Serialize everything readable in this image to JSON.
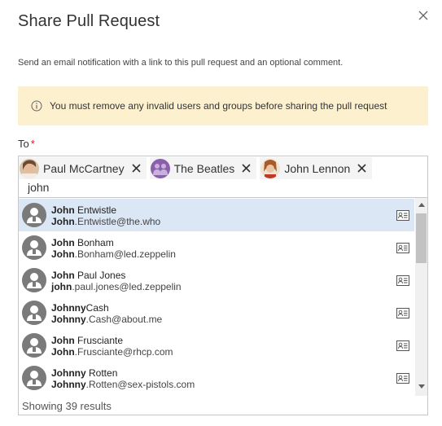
{
  "dialog": {
    "title": "Share Pull Request",
    "description": "Send an email notification with a link to this pull request and an optional comment.",
    "warning": "You must remove any invalid users and groups before sharing the pull request",
    "to_label": "To",
    "required_mark": "*"
  },
  "recipients": [
    {
      "name": "Paul McCartney",
      "avatar": "photo-avatar"
    },
    {
      "name": "The Beatles",
      "avatar": "group-avatar"
    },
    {
      "name": "John Lennon",
      "avatar": "photo-avatar"
    }
  ],
  "search": {
    "query": "john"
  },
  "results": {
    "items": [
      {
        "match": "John",
        "name_rest": " Entwistle",
        "email_match": "John",
        "email_rest": ".Entwistle@the.who",
        "selected": true
      },
      {
        "match": "John",
        "name_rest": " Bonham",
        "email_match": "John",
        "email_rest": ".Bonham@led.zeppelin",
        "selected": false
      },
      {
        "match": "John",
        "name_rest": " Paul Jones",
        "email_match": "john",
        "email_rest": ".paul.jones@led.zeppelin",
        "selected": false
      },
      {
        "match": "Johnny",
        "name_rest": "Cash",
        "email_match": "Johnny",
        "email_rest": ".Cash@about.me",
        "selected": false
      },
      {
        "match": "John",
        "name_rest": " Frusciante",
        "email_match": "John",
        "email_rest": ".Frusciante@rhcp.com",
        "selected": false
      },
      {
        "match": "Johnny",
        "name_rest": " Rotten",
        "email_match": "Johnny",
        "email_rest": ".Rotten@sex-pistols.com",
        "selected": false
      }
    ],
    "count_text": "Showing 39 results"
  },
  "icons": {
    "close": "close-icon",
    "info": "info-icon",
    "remove": "remove-icon",
    "person": "person-icon",
    "contact_card": "contact-card-icon"
  },
  "colors": {
    "warning_bg": "#fcf0ce",
    "selected_row": "#dbe7f5",
    "required": "#e81123"
  }
}
